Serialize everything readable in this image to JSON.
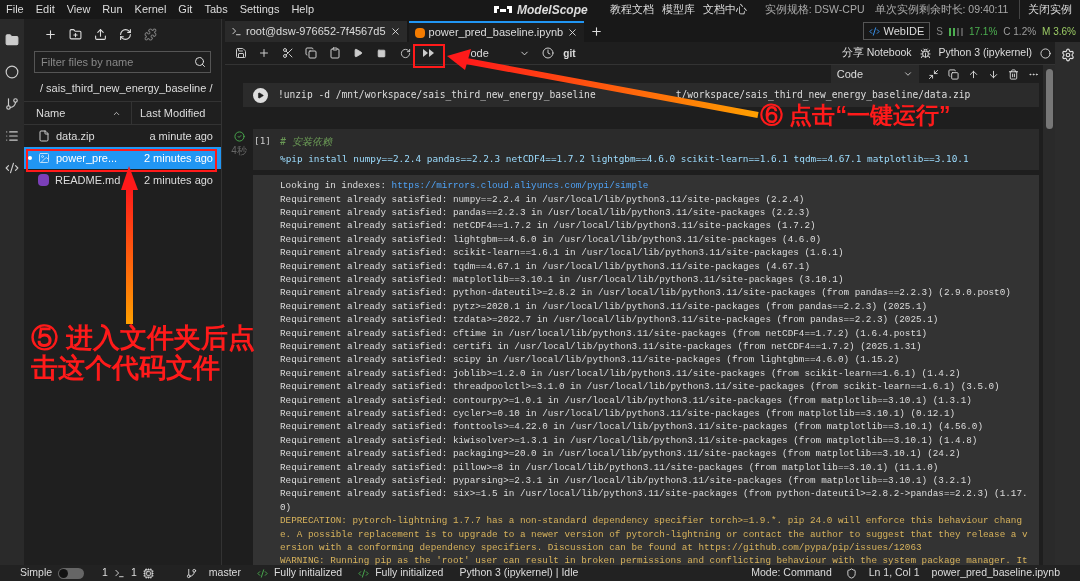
{
  "menu_bar": {
    "items": [
      "File",
      "Edit",
      "View",
      "Run",
      "Kernel",
      "Git",
      "Tabs",
      "Settings",
      "Help"
    ],
    "brand": "ModelScope",
    "links": [
      "教程文档",
      "模型库",
      "文档中心"
    ],
    "instance_spec": "实例规格: DSW-CPU",
    "remaining_time": "单次实例剩余时长: 09:40:11",
    "close_button": "关闭实例"
  },
  "file_browser": {
    "filter_placeholder": "Filter files by name",
    "breadcrumb": "/ sais_third_new_energy_baseline /",
    "columns": [
      "Name",
      "Last Modified"
    ],
    "files": [
      {
        "name": "data.zip",
        "modified": "a minute ago",
        "kind": "file",
        "selected": false
      },
      {
        "name": "power_pre...",
        "modified": "2 minutes ago",
        "kind": "notebook",
        "selected": true
      },
      {
        "name": "README.md",
        "modified": "2 minutes ago",
        "kind": "markdown",
        "selected": false
      }
    ]
  },
  "tabs": [
    {
      "label": "root@dsw-976652-7f4567d5",
      "kind": "terminal",
      "selected": false
    },
    {
      "label": "power_pred_baseline.ipynb",
      "kind": "notebook",
      "selected": true
    }
  ],
  "resources": {
    "webide": "WebIDE",
    "storage": "S",
    "storage_pct": "17.1%",
    "cpu": "C 1.2%",
    "mem": "M 3.6%"
  },
  "toolbar": {
    "cell_type": "ode",
    "git": "git",
    "share": "分享 Notebook",
    "kernel": "Python 3 (ipykernel)"
  },
  "cell_toolbar": {
    "cell_type": "Code"
  },
  "cells": [
    {
      "kind": "command",
      "parts": [
        "!unzip -d /mnt/workspace/sais_third_new_energy_baseline",
        "t/workspace/sais_third_new_energy_baseline/data.zip"
      ]
    },
    {
      "kind": "code",
      "prompt": "[1]",
      "executed": true,
      "duration": "4秒",
      "comment": "# 安装依赖",
      "code": "%pip install numpy==2.2.4 pandas==2.2.3 netCDF4==1.7.2 lightgbm==4.6.0 scikit-learn==1.6.1 tqdm==4.67.1 matplotlib==3.10.1",
      "output": [
        {
          "kind": "index",
          "text": "Looking in indexes:",
          "link": "https://mirrors.cloud.aliyuncs.com/pypi/simple"
        },
        {
          "kind": "text",
          "text": "Requirement already satisfied: numpy==2.2.4 in /usr/local/lib/python3.11/site-packages (2.2.4)"
        },
        {
          "kind": "text",
          "text": "Requirement already satisfied: pandas==2.2.3 in /usr/local/lib/python3.11/site-packages (2.2.3)"
        },
        {
          "kind": "text",
          "text": "Requirement already satisfied: netCDF4==1.7.2 in /usr/local/lib/python3.11/site-packages (1.7.2)"
        },
        {
          "kind": "text",
          "text": "Requirement already satisfied: lightgbm==4.6.0 in /usr/local/lib/python3.11/site-packages (4.6.0)"
        },
        {
          "kind": "text",
          "text": "Requirement already satisfied: scikit-learn==1.6.1 in /usr/local/lib/python3.11/site-packages (1.6.1)"
        },
        {
          "kind": "text",
          "text": "Requirement already satisfied: tqdm==4.67.1 in /usr/local/lib/python3.11/site-packages (4.67.1)"
        },
        {
          "kind": "text",
          "text": "Requirement already satisfied: matplotlib==3.10.1 in /usr/local/lib/python3.11/site-packages (3.10.1)"
        },
        {
          "kind": "text",
          "text": "Requirement already satisfied: python-dateutil>=2.8.2 in /usr/local/lib/python3.11/site-packages (from pandas==2.2.3) (2.9.0.post0)"
        },
        {
          "kind": "text",
          "text": "Requirement already satisfied: pytz>=2020.1 in /usr/local/lib/python3.11/site-packages (from pandas==2.2.3) (2025.1)"
        },
        {
          "kind": "text",
          "text": "Requirement already satisfied: tzdata>=2022.7 in /usr/local/lib/python3.11/site-packages (from pandas==2.2.3) (2025.1)"
        },
        {
          "kind": "text",
          "text": "Requirement already satisfied: cftime in /usr/local/lib/python3.11/site-packages (from netCDF4==1.7.2) (1.6.4.post1)"
        },
        {
          "kind": "text",
          "text": "Requirement already satisfied: certifi in /usr/local/lib/python3.11/site-packages (from netCDF4==1.7.2) (2025.1.31)"
        },
        {
          "kind": "text",
          "text": "Requirement already satisfied: scipy in /usr/local/lib/python3.11/site-packages (from lightgbm==4.6.0) (1.15.2)"
        },
        {
          "kind": "text",
          "text": "Requirement already satisfied: joblib>=1.2.0 in /usr/local/lib/python3.11/site-packages (from scikit-learn==1.6.1) (1.4.2)"
        },
        {
          "kind": "text",
          "text": "Requirement already satisfied: threadpoolctl>=3.1.0 in /usr/local/lib/python3.11/site-packages (from scikit-learn==1.6.1) (3.5.0)"
        },
        {
          "kind": "text",
          "text": "Requirement already satisfied: contourpy>=1.0.1 in /usr/local/lib/python3.11/site-packages (from matplotlib==3.10.1) (1.3.1)"
        },
        {
          "kind": "text",
          "text": "Requirement already satisfied: cycler>=0.10 in /usr/local/lib/python3.11/site-packages (from matplotlib==3.10.1) (0.12.1)"
        },
        {
          "kind": "text",
          "text": "Requirement already satisfied: fonttools>=4.22.0 in /usr/local/lib/python3.11/site-packages (from matplotlib==3.10.1) (4.56.0)"
        },
        {
          "kind": "text",
          "text": "Requirement already satisfied: kiwisolver>=1.3.1 in /usr/local/lib/python3.11/site-packages (from matplotlib==3.10.1) (1.4.8)"
        },
        {
          "kind": "text",
          "text": "Requirement already satisfied: packaging>=20.0 in /usr/local/lib/python3.11/site-packages (from matplotlib==3.10.1) (24.2)"
        },
        {
          "kind": "text",
          "text": "Requirement already satisfied: pillow>=8 in /usr/local/lib/python3.11/site-packages (from matplotlib==3.10.1) (11.1.0)"
        },
        {
          "kind": "text",
          "text": "Requirement already satisfied: pyparsing>=2.3.1 in /usr/local/lib/python3.11/site-packages (from matplotlib==3.10.1) (3.2.1)"
        },
        {
          "kind": "text",
          "text": "Requirement already satisfied: six>=1.5 in /usr/local/lib/python3.11/site-packages (from python-dateutil>=2.8.2->pandas==2.2.3) (1.17."
        },
        {
          "kind": "text",
          "text": "0)"
        },
        {
          "kind": "warning",
          "text": "DEPRECATION: pytorch-lightning 1.7.7 has a non-standard dependency specifier torch>=1.9.*. pip 24.0 will enforce this behaviour chang"
        },
        {
          "kind": "warning",
          "text": "e. A possible replacement is to upgrade to a newer version of pytorch-lightning or contact the author to suggest that they release a v"
        },
        {
          "kind": "warning",
          "text": "ersion with a conforming dependency specifiers. Discussion can be found at https://github.com/pypa/pip/issues/12063"
        },
        {
          "kind": "warning",
          "text": "WARNING: Running pip as the 'root' user can result in broken permissions and conflicting behaviour with the system package manager. It"
        }
      ]
    }
  ],
  "status_bar": {
    "mode_label": "Simple",
    "simple_mode": false,
    "terminals": "1",
    "kernels": "1",
    "branch": "master",
    "status_1": "Fully initialized",
    "status_2": "Fully initialized",
    "kernel_status": "Python 3 (ipykernel) | Idle",
    "mode": "Mode: Command",
    "position": "Ln 1, Col 1",
    "file": "power_pred_baseline.ipynb"
  },
  "annotations": [
    {
      "kind": "step",
      "text": "⑥ 点击“一键运行”"
    },
    {
      "kind": "step",
      "text": "⑤ 进入文件夹后点击这个代码文件"
    }
  ]
}
